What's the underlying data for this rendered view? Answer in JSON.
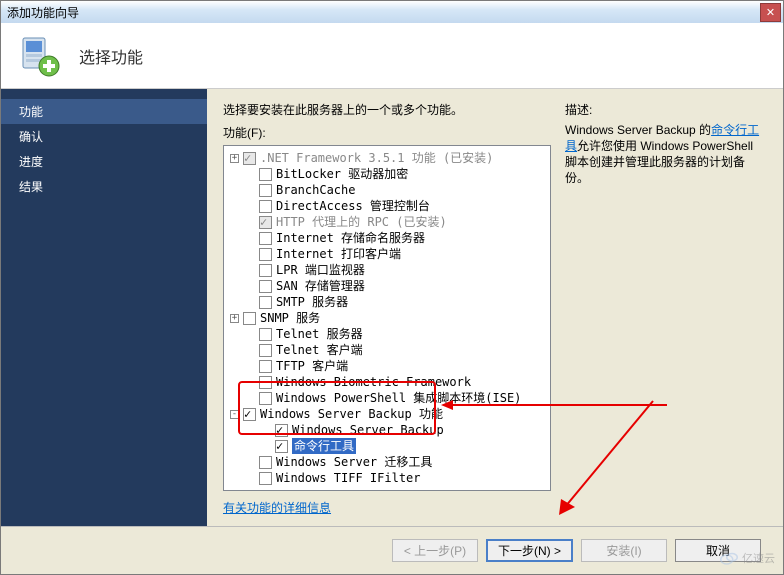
{
  "window": {
    "title": "添加功能向导"
  },
  "banner": {
    "title": "选择功能"
  },
  "sidebar": {
    "items": [
      {
        "label": "功能",
        "active": true
      },
      {
        "label": "确认",
        "active": false
      },
      {
        "label": "进度",
        "active": false
      },
      {
        "label": "结果",
        "active": false
      }
    ]
  },
  "main": {
    "instruction": "选择要安装在此服务器上的一个或多个功能。",
    "tree_label": "功能(F):",
    "desc_label": "描述:",
    "desc_prefix": "Windows Server Backup 的",
    "desc_link": "命令行工具",
    "desc_suffix": "允许您使用 Windows PowerShell 脚本创建并管理此服务器的计划备份。",
    "more_link": "有关功能的详细信息",
    "tree": [
      {
        "indent": 0,
        "exp": "+",
        "checked": true,
        "disabled": true,
        "label": ".NET Framework 3.5.1 功能  (已安装)"
      },
      {
        "indent": 1,
        "exp": "",
        "checked": false,
        "disabled": false,
        "label": "BitLocker 驱动器加密"
      },
      {
        "indent": 1,
        "exp": "",
        "checked": false,
        "disabled": false,
        "label": "BranchCache"
      },
      {
        "indent": 1,
        "exp": "",
        "checked": false,
        "disabled": false,
        "label": "DirectAccess 管理控制台"
      },
      {
        "indent": 1,
        "exp": "",
        "checked": true,
        "disabled": true,
        "label": "HTTP 代理上的 RPC  (已安装)"
      },
      {
        "indent": 1,
        "exp": "",
        "checked": false,
        "disabled": false,
        "label": "Internet 存储命名服务器"
      },
      {
        "indent": 1,
        "exp": "",
        "checked": false,
        "disabled": false,
        "label": "Internet 打印客户端"
      },
      {
        "indent": 1,
        "exp": "",
        "checked": false,
        "disabled": false,
        "label": "LPR 端口监视器"
      },
      {
        "indent": 1,
        "exp": "",
        "checked": false,
        "disabled": false,
        "label": "SAN 存储管理器"
      },
      {
        "indent": 1,
        "exp": "",
        "checked": false,
        "disabled": false,
        "label": "SMTP 服务器"
      },
      {
        "indent": 0,
        "exp": "+",
        "checked": false,
        "disabled": false,
        "label": "SNMP 服务"
      },
      {
        "indent": 1,
        "exp": "",
        "checked": false,
        "disabled": false,
        "label": "Telnet 服务器"
      },
      {
        "indent": 1,
        "exp": "",
        "checked": false,
        "disabled": false,
        "label": "Telnet 客户端"
      },
      {
        "indent": 1,
        "exp": "",
        "checked": false,
        "disabled": false,
        "label": "TFTP 客户端"
      },
      {
        "indent": 1,
        "exp": "",
        "checked": false,
        "disabled": false,
        "label": "Windows Biometric Framework"
      },
      {
        "indent": 1,
        "exp": "",
        "checked": false,
        "disabled": false,
        "label": "Windows PowerShell 集成脚本环境(ISE)"
      },
      {
        "indent": 0,
        "exp": "-",
        "checked": true,
        "disabled": false,
        "label": "Windows Server Backup 功能"
      },
      {
        "indent": 2,
        "exp": "",
        "checked": true,
        "disabled": false,
        "label": "Windows Server Backup"
      },
      {
        "indent": 2,
        "exp": "",
        "checked": true,
        "disabled": false,
        "label": "命令行工具",
        "selected": true
      },
      {
        "indent": 1,
        "exp": "",
        "checked": false,
        "disabled": false,
        "label": "Windows Server 迁移工具"
      },
      {
        "indent": 1,
        "exp": "",
        "checked": false,
        "disabled": false,
        "label": "Windows TIFF IFilter"
      }
    ]
  },
  "footer": {
    "prev": "< 上一步(P)",
    "next": "下一步(N) >",
    "install": "安装(I)",
    "cancel": "取消"
  },
  "watermark": "亿速云"
}
